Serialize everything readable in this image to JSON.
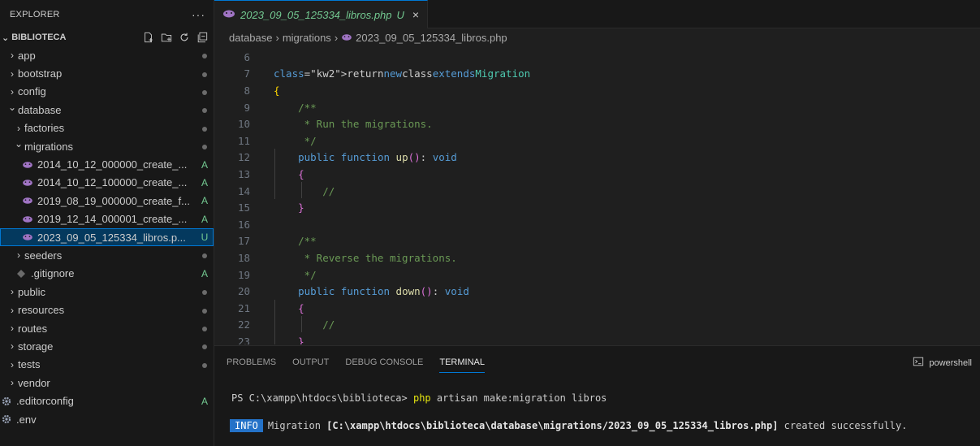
{
  "sidebar": {
    "header": "EXPLORER",
    "more": "···",
    "project": "BIBLIOTECA",
    "items": [
      {
        "label": "app",
        "kind": "folder",
        "open": false,
        "depth": 0,
        "status": "dot"
      },
      {
        "label": "bootstrap",
        "kind": "folder",
        "open": false,
        "depth": 0,
        "status": "dot"
      },
      {
        "label": "config",
        "kind": "folder",
        "open": false,
        "depth": 0,
        "status": "dot"
      },
      {
        "label": "database",
        "kind": "folder",
        "open": true,
        "depth": 0,
        "status": "dot"
      },
      {
        "label": "factories",
        "kind": "folder",
        "open": false,
        "depth": 1,
        "status": "dot"
      },
      {
        "label": "migrations",
        "kind": "folder",
        "open": true,
        "depth": 1,
        "status": "dot"
      },
      {
        "label": "2014_10_12_000000_create_...",
        "kind": "php",
        "depth": 2,
        "status": "A"
      },
      {
        "label": "2014_10_12_100000_create_...",
        "kind": "php",
        "depth": 2,
        "status": "A"
      },
      {
        "label": "2019_08_19_000000_create_f...",
        "kind": "php",
        "depth": 2,
        "status": "A"
      },
      {
        "label": "2019_12_14_000001_create_...",
        "kind": "php",
        "depth": 2,
        "status": "A"
      },
      {
        "label": "2023_09_05_125334_libros.p...",
        "kind": "php",
        "depth": 2,
        "status": "U",
        "selected": true
      },
      {
        "label": "seeders",
        "kind": "folder",
        "open": false,
        "depth": 1,
        "status": "dot"
      },
      {
        "label": ".gitignore",
        "kind": "git",
        "depth": 1,
        "status": "A"
      },
      {
        "label": "public",
        "kind": "folder",
        "open": false,
        "depth": 0,
        "status": "dot"
      },
      {
        "label": "resources",
        "kind": "folder",
        "open": false,
        "depth": 0,
        "status": "dot"
      },
      {
        "label": "routes",
        "kind": "folder",
        "open": false,
        "depth": 0,
        "status": "dot"
      },
      {
        "label": "storage",
        "kind": "folder",
        "open": false,
        "depth": 0,
        "status": "dot"
      },
      {
        "label": "tests",
        "kind": "folder",
        "open": false,
        "depth": 0,
        "status": "dot"
      },
      {
        "label": "vendor",
        "kind": "folder",
        "open": false,
        "depth": 0,
        "status": ""
      },
      {
        "label": ".editorconfig",
        "kind": "gear",
        "depth": 0,
        "status": "A"
      },
      {
        "label": ".env",
        "kind": "gear",
        "depth": 0,
        "status": ""
      }
    ]
  },
  "editor": {
    "tab": {
      "label": "2023_09_05_125334_libros.php",
      "status": "U",
      "close": "×"
    },
    "breadcrumb": [
      "database",
      "migrations",
      "2023_09_05_125334_libros.php"
    ],
    "lines": [
      {
        "n": "6",
        "text": ""
      },
      {
        "n": "7",
        "text": "return new class extends Migration"
      },
      {
        "n": "8",
        "text": "{"
      },
      {
        "n": "9",
        "text": "    /**"
      },
      {
        "n": "10",
        "text": "     * Run the migrations."
      },
      {
        "n": "11",
        "text": "     */"
      },
      {
        "n": "12",
        "text": "    public function up(): void"
      },
      {
        "n": "13",
        "text": "    {"
      },
      {
        "n": "14",
        "text": "        //"
      },
      {
        "n": "15",
        "text": "    }"
      },
      {
        "n": "16",
        "text": ""
      },
      {
        "n": "17",
        "text": "    /**"
      },
      {
        "n": "18",
        "text": "     * Reverse the migrations."
      },
      {
        "n": "19",
        "text": "     */"
      },
      {
        "n": "20",
        "text": "    public function down(): void"
      },
      {
        "n": "21",
        "text": "    {"
      },
      {
        "n": "22",
        "text": "        //"
      },
      {
        "n": "23",
        "text": "    }"
      }
    ]
  },
  "panel": {
    "tabs": [
      "PROBLEMS",
      "OUTPUT",
      "DEBUG CONSOLE",
      "TERMINAL"
    ],
    "active_tab": "TERMINAL",
    "shell": "powershell",
    "terminal": {
      "prompt": "PS C:\\xampp\\htdocs\\biblioteca> ",
      "cmd": "php",
      "args": " artisan make:migration libros",
      "badge": "INFO",
      "msg_pre": "Migration ",
      "msg_path": "[C:\\xampp\\htdocs\\biblioteca\\database\\migrations/2023_09_05_125334_libros.php]",
      "msg_post": " created successfully."
    }
  },
  "colors": {
    "accent": "#0078d4",
    "git_added": "#73c991",
    "php_icon": "#a074c4"
  }
}
